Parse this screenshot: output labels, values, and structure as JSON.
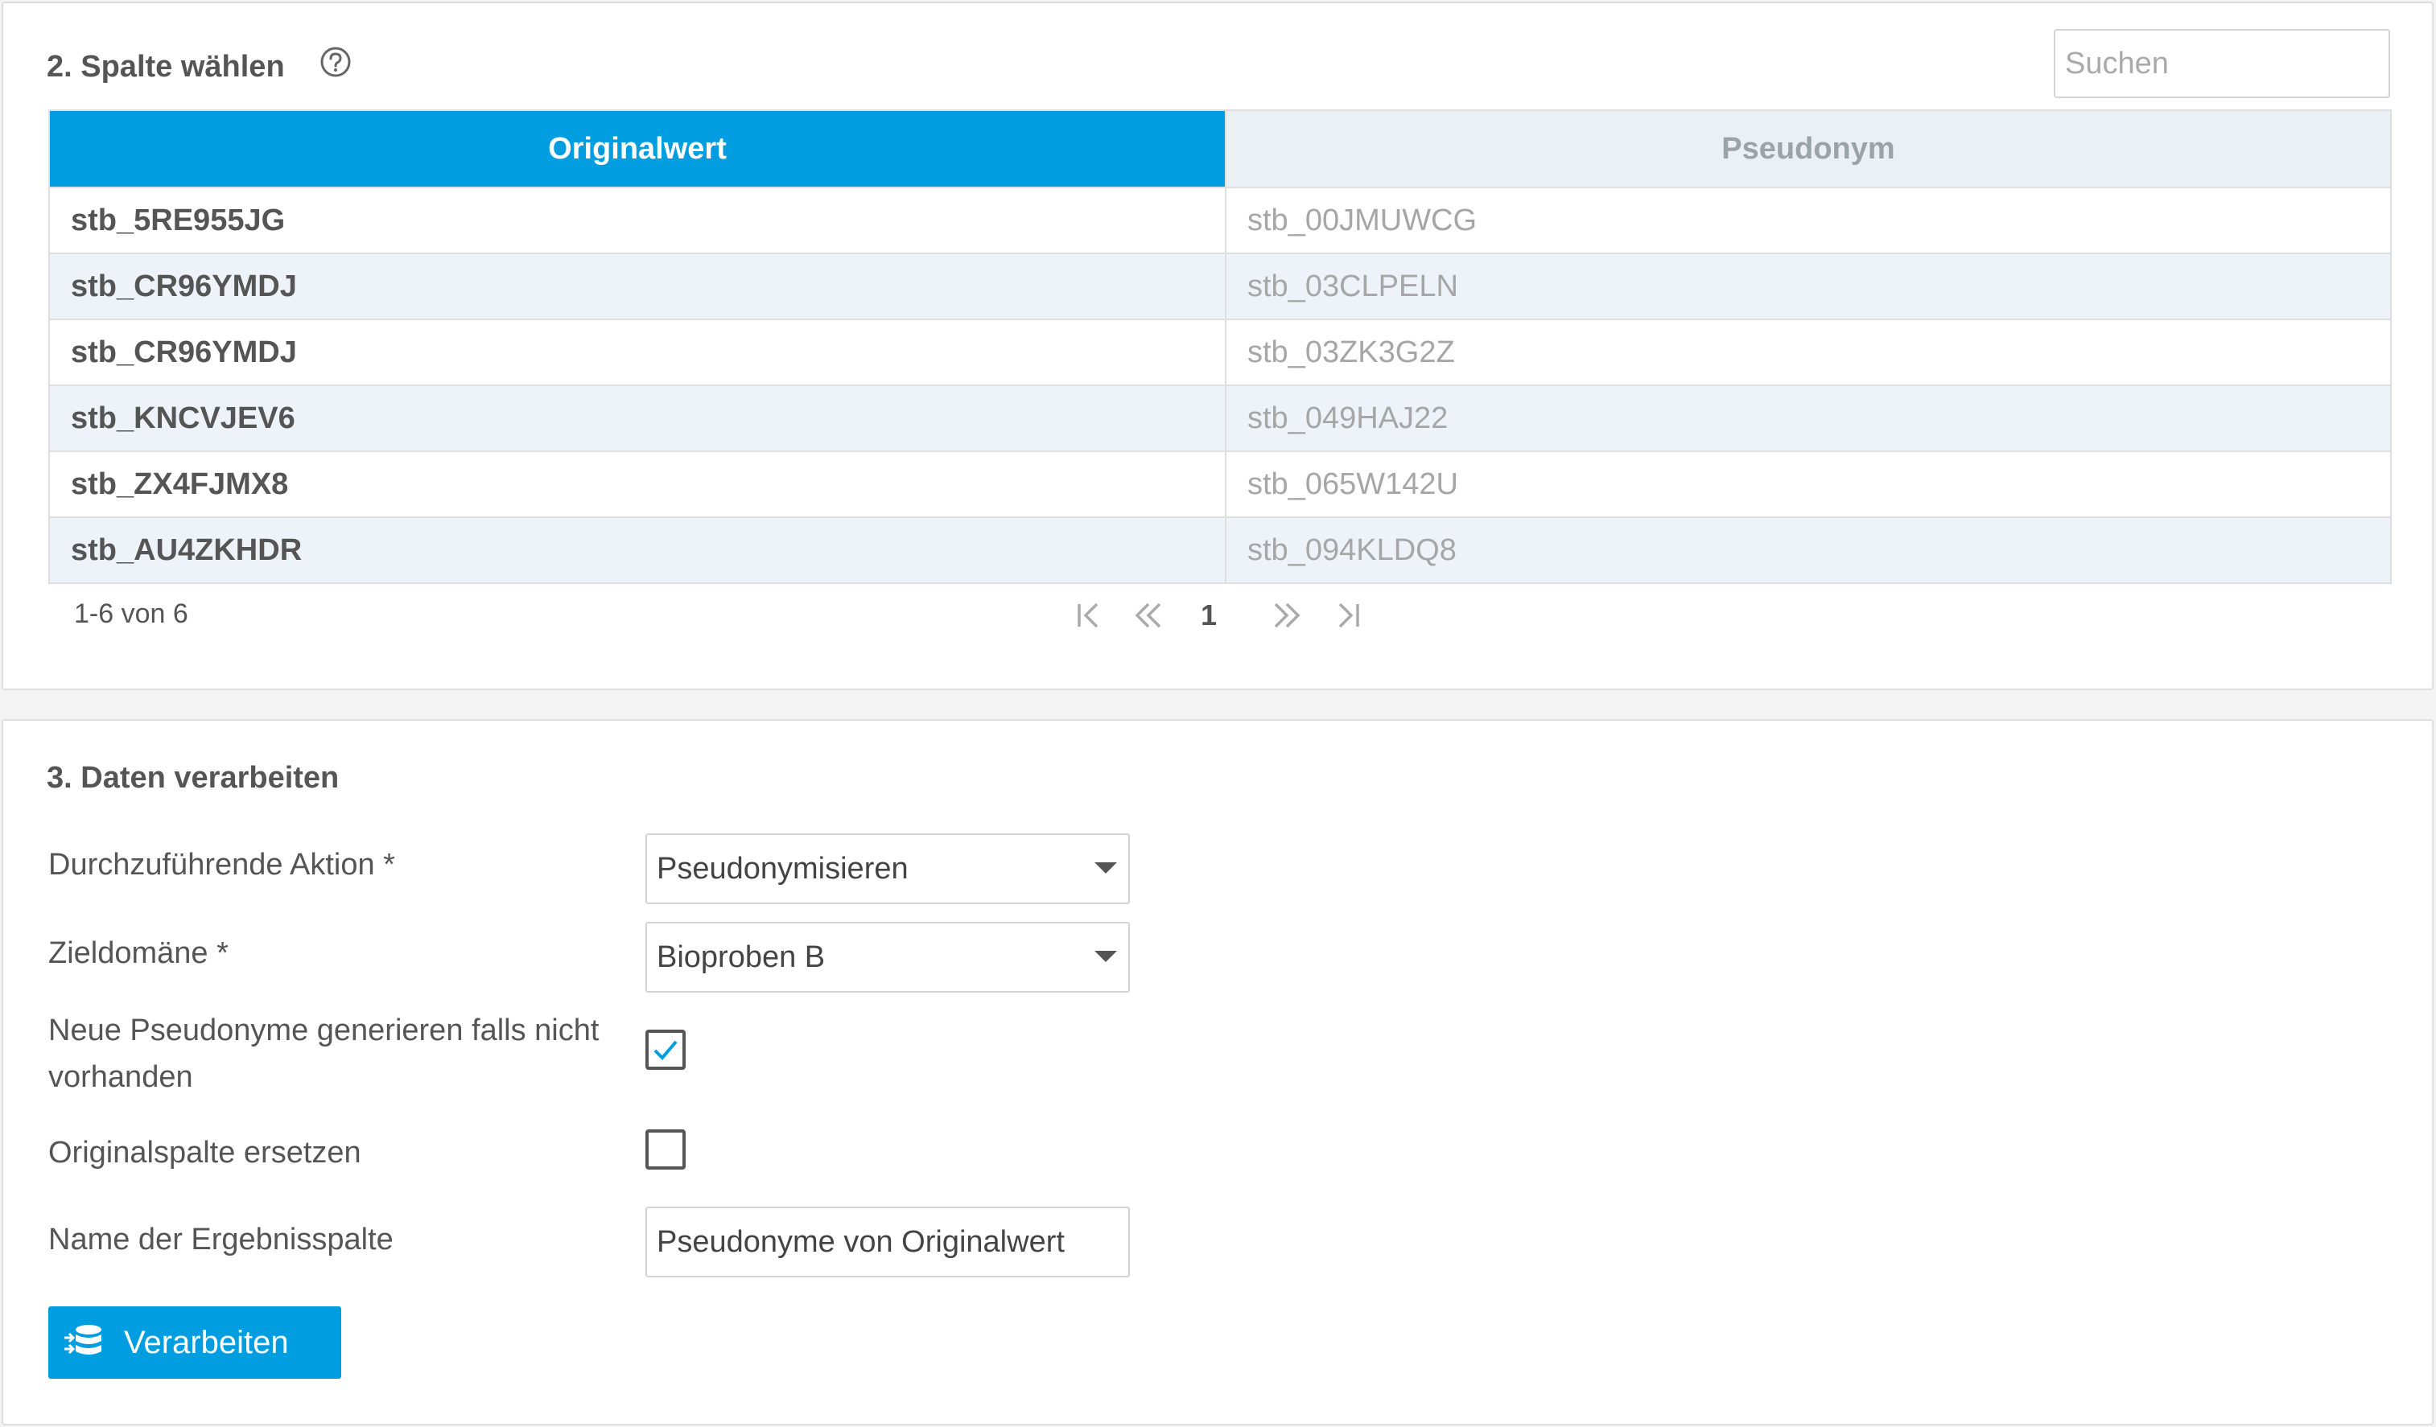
{
  "section_select": {
    "title": "2. Spalte wählen",
    "search_placeholder": "Suchen",
    "columns": [
      "Originalwert",
      "Pseudonym"
    ],
    "rows": [
      {
        "original": "stb_5RE955JG",
        "pseudonym": "stb_00JMUWCG"
      },
      {
        "original": "stb_CR96YMDJ",
        "pseudonym": "stb_03CLPELN"
      },
      {
        "original": "stb_CR96YMDJ",
        "pseudonym": "stb_03ZK3G2Z"
      },
      {
        "original": "stb_KNCVJEV6",
        "pseudonym": "stb_049HAJ22"
      },
      {
        "original": "stb_ZX4FJMX8",
        "pseudonym": "stb_065W142U"
      },
      {
        "original": "stb_AU4ZKHDR",
        "pseudonym": "stb_094KLDQ8"
      }
    ],
    "paging_info": "1-6 von 6",
    "current_page": "1"
  },
  "section_process": {
    "title": "3. Daten verarbeiten",
    "action_label": "Durchzuführende Aktion  *",
    "action_value": "Pseudonymisieren",
    "domain_label": "Zieldomäne  *",
    "domain_value": "Bioproben B",
    "generate_label": "Neue Pseudonyme generieren falls nicht vorhanden",
    "generate_checked": true,
    "replace_label": "Originalspalte ersetzen",
    "replace_checked": false,
    "result_name_label": "Name der Ergebnisspalte",
    "result_name_value": "Pseudonyme von Originalwert",
    "submit_label": "Verarbeiten"
  },
  "colors": {
    "accent": "#009de0",
    "header_inactive": "#eaf0f3",
    "row_stripe": "#eef3f9"
  }
}
